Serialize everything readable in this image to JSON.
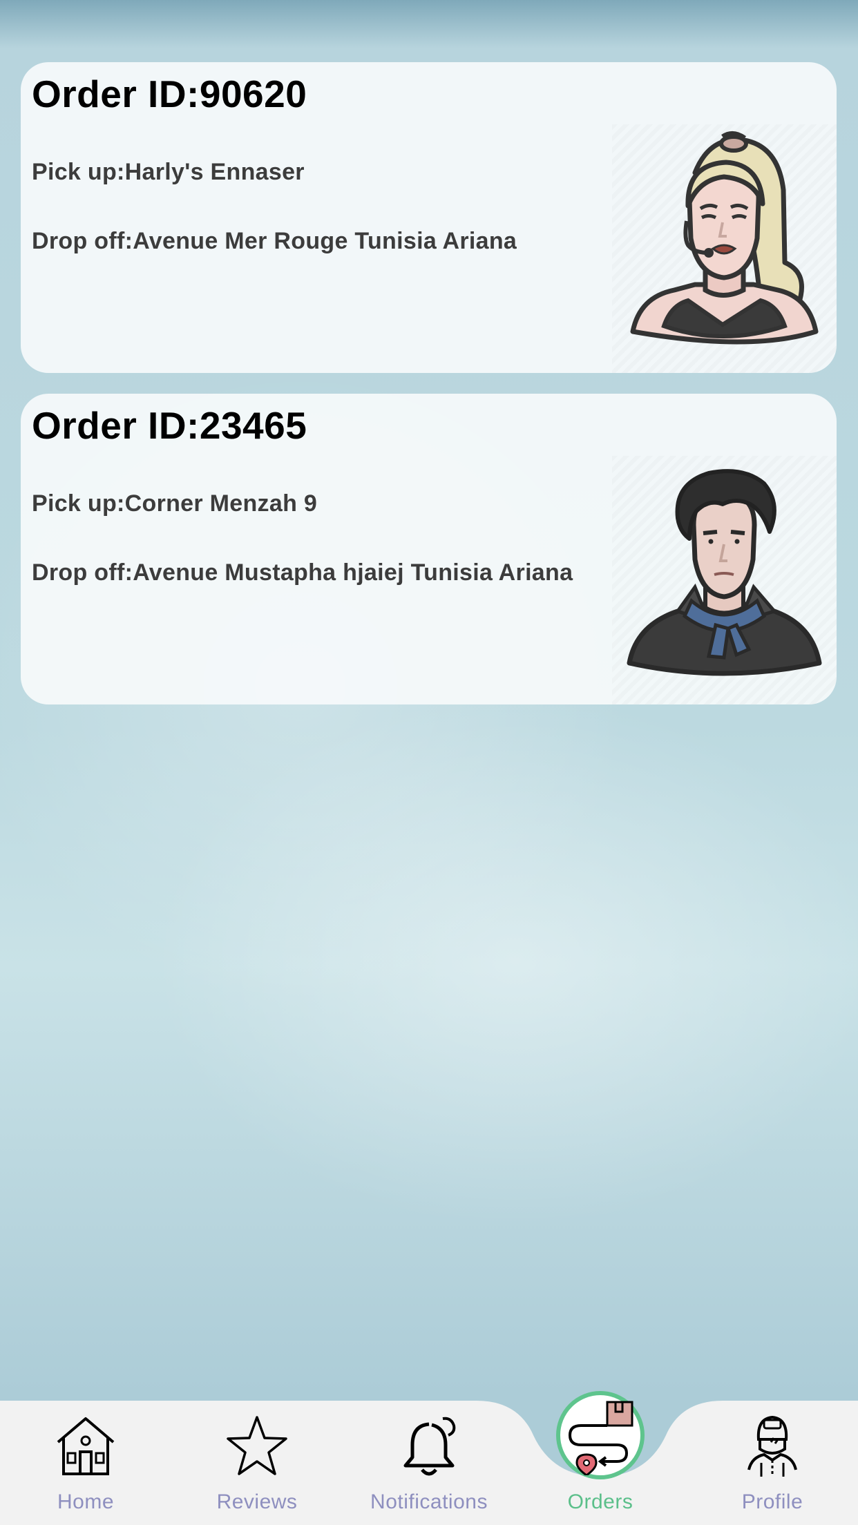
{
  "orders": [
    {
      "order_id": "Order ID:90620",
      "pickup": "Pick up:Harly's Ennaser",
      "dropoff": "Drop off:Avenue Mer Rouge Tunisia Ariana",
      "avatar": "blonde-woman-avatar"
    },
    {
      "order_id": "Order ID:23465",
      "pickup": "Pick up:Corner Menzah 9",
      "dropoff": "Drop off:Avenue Mustapha hjaiej Tunisia Ariana",
      "avatar": "dark-haired-man-avatar"
    }
  ],
  "nav": {
    "home": "Home",
    "reviews": "Reviews",
    "notifications": "Notifications",
    "orders": "Orders",
    "profile": "Profile",
    "active": "orders",
    "active_color": "#5bbf8a",
    "inactive_color": "#8e8fbf"
  }
}
